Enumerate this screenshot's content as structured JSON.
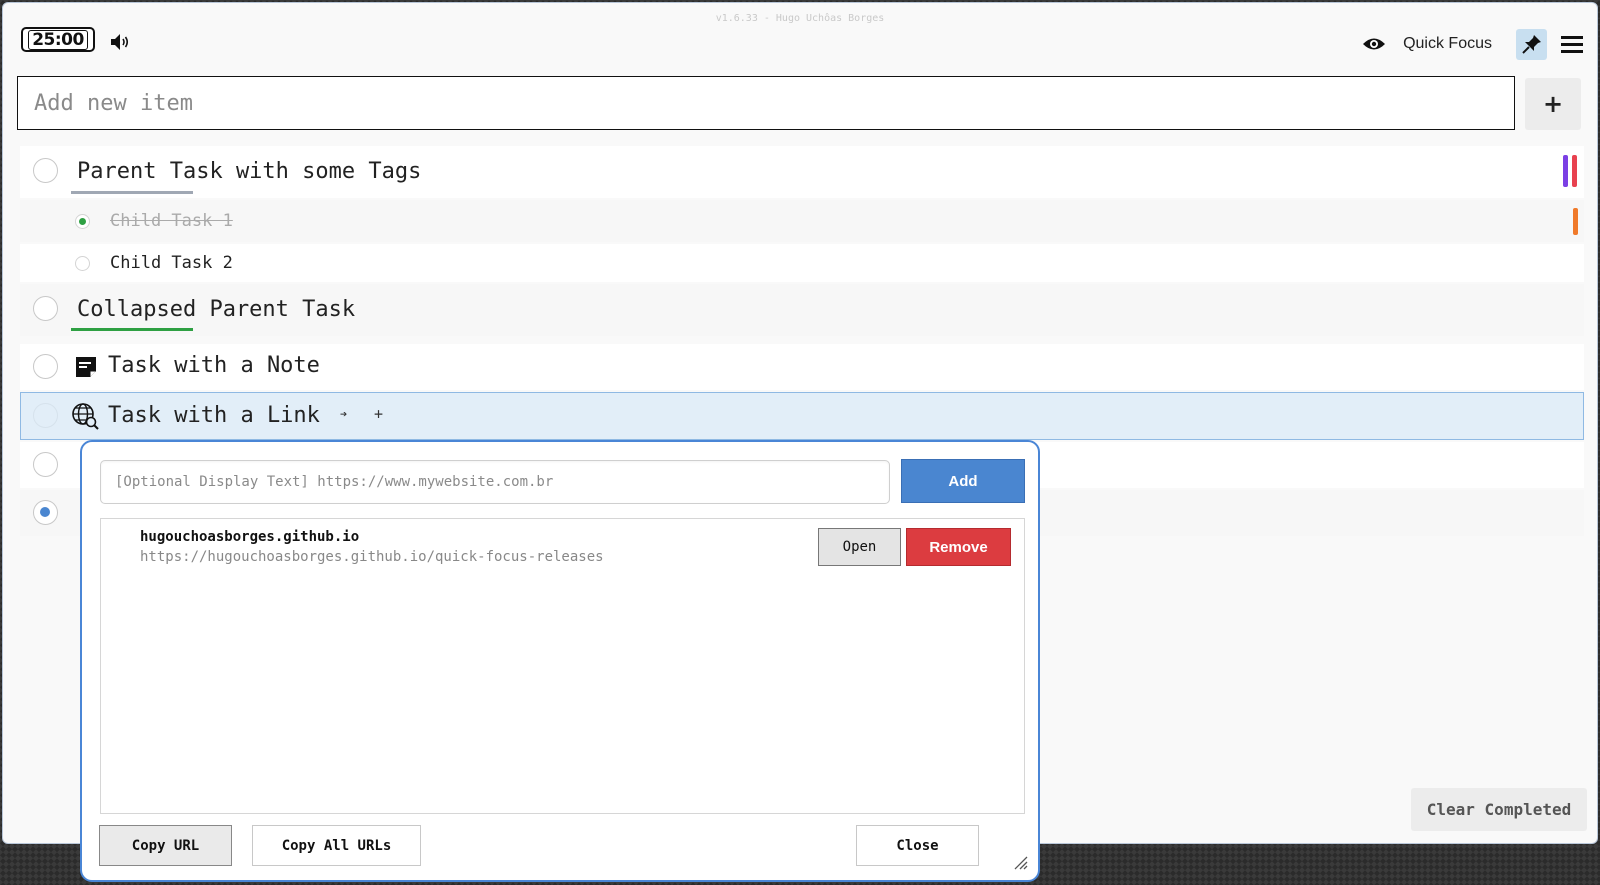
{
  "header": {
    "version": "v1.6.33 - Hugo Uchôas Borges",
    "timer": "25:00",
    "speaker_icon": "speaker-icon",
    "eye_icon": "eye-icon",
    "app_name": "Quick Focus",
    "pin_icon": "pin-icon",
    "menu_icon": "hamburger-menu-icon"
  },
  "add_item": {
    "placeholder": "Add new item",
    "button": "+"
  },
  "tasks": [
    {
      "label": "Parent Task with some Tags",
      "underline_color": "#a0a8b4",
      "tag_colors": [
        "#7b3fe4",
        "#e8414f"
      ]
    },
    {
      "label": "Child Task 1",
      "completed": true,
      "tag_colors": [
        "#f07a2a"
      ]
    },
    {
      "label": "Child Task 2",
      "completed": false
    },
    {
      "label": "Collapsed Parent Task",
      "underline_color": "#2ea043"
    },
    {
      "label": "Task with a Note",
      "icon": "note-icon"
    },
    {
      "label": "Task with a Link",
      "icon": "globe-link-icon",
      "arrow": "➔",
      "plus": "+"
    }
  ],
  "link_popup": {
    "input_placeholder": "[Optional Display Text] https://www.mywebsite.com.br",
    "add_label": "Add",
    "links": [
      {
        "name": "hugouchoasborges.github.io",
        "url": "https://hugouchoasborges.github.io/quick-focus-releases",
        "open_label": "Open",
        "remove_label": "Remove"
      }
    ],
    "copy_url_label": "Copy URL",
    "copy_all_label": "Copy All URLs",
    "close_label": "Close"
  },
  "footer": {
    "clear_completed": "Clear Completed"
  },
  "colors": {
    "accent": "#4a86d0",
    "danger": "#dc3c40",
    "selected_row": "#e2eef8",
    "completed_dot": "#2ea043"
  }
}
